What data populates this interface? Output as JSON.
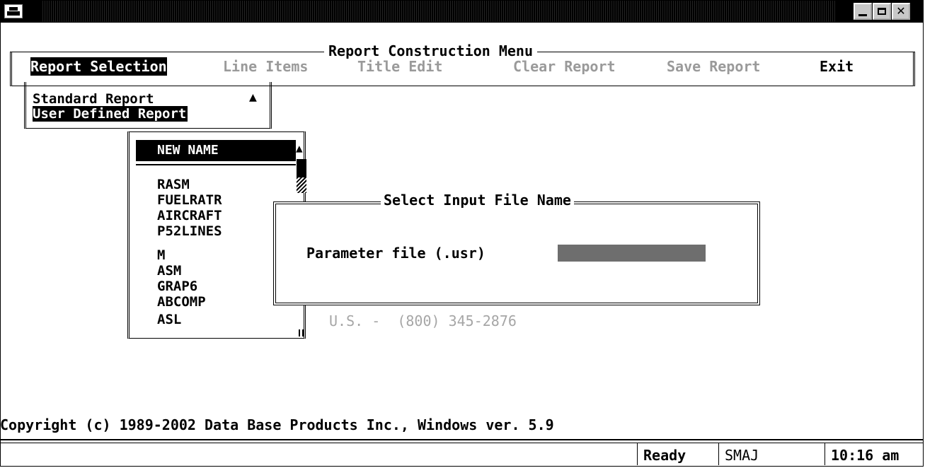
{
  "menu": {
    "title": "Report Construction Menu",
    "items": [
      {
        "label": "Report Selection"
      },
      {
        "label": "Line Items"
      },
      {
        "label": "Title Edit"
      },
      {
        "label": "Clear Report"
      },
      {
        "label": "Save Report"
      },
      {
        "label": "Exit"
      }
    ]
  },
  "report_types": {
    "items": [
      "Standard Report",
      "User Defined Report"
    ],
    "selected": "User Defined Report"
  },
  "name_list": {
    "selected": "NEW NAME",
    "items": [
      "RASM",
      "FUELRATR",
      "AIRCRAFT",
      "P52LINES",
      "M",
      "ASM",
      "GRAP6",
      "ABCOMP",
      "ASL"
    ]
  },
  "dialog": {
    "title": "Select Input File Name",
    "field_label": "Parameter file (.usr)",
    "field_value": ""
  },
  "background_text": {
    "phone": "U.S. -  (800) 345-2876",
    "copyright": "Copyright (c) 1989-2002 Data Base Products Inc., Windows ver. 5.9"
  },
  "status_bar": {
    "message": "",
    "state": "Ready",
    "user": "SMAJ",
    "time": "10:16 am"
  }
}
